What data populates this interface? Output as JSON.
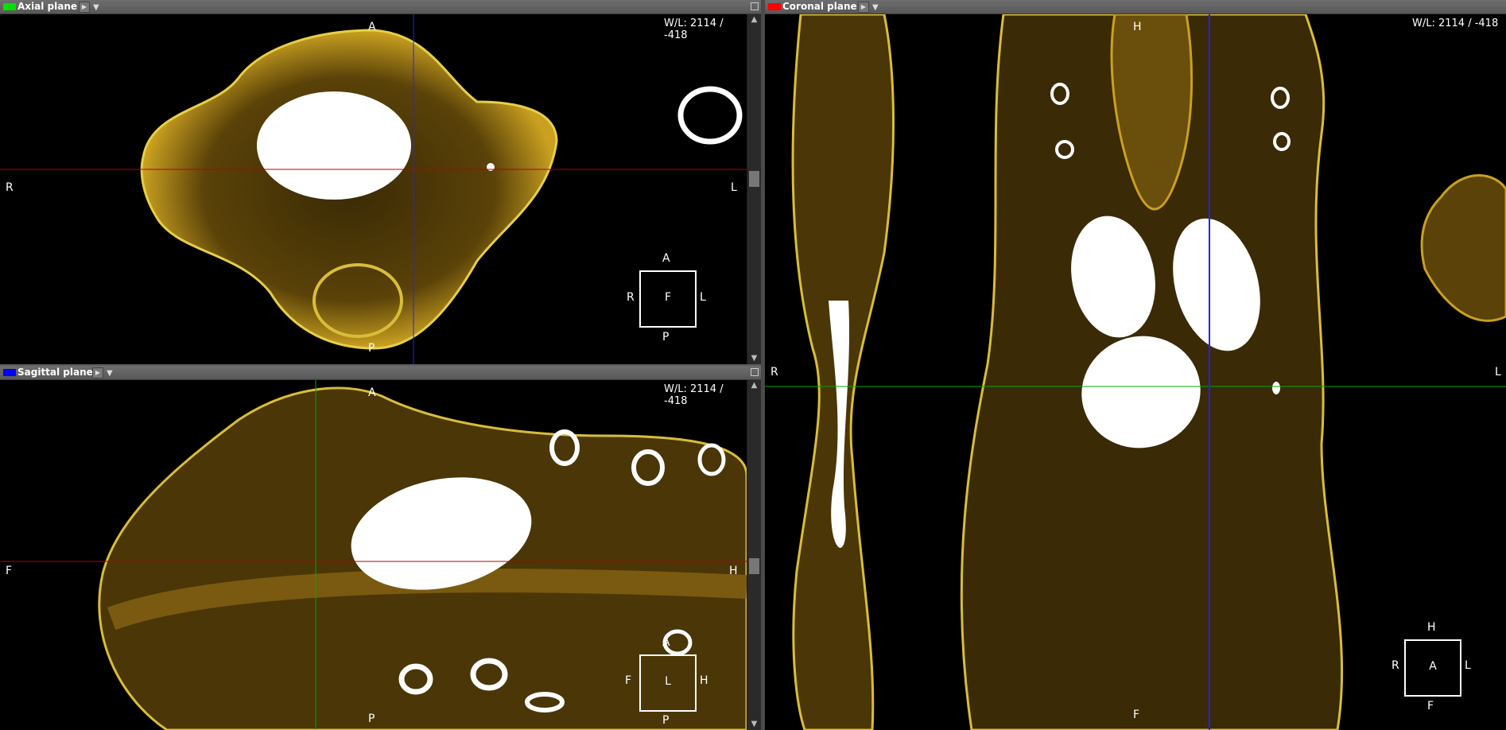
{
  "panes": {
    "axial": {
      "title": "Axial plane",
      "color": "#00e000",
      "wl": "W/L: 2114 / -418",
      "top": "A",
      "bottom": "P",
      "left": "R",
      "right": "L",
      "box": {
        "top": "A",
        "bottom": "P",
        "left": "R",
        "right": "L",
        "center": "F"
      }
    },
    "sagittal": {
      "title": "Sagittal plane",
      "color": "#0000ff",
      "wl": "W/L: 2114 / -418",
      "top": "A",
      "bottom": "P",
      "left": "F",
      "right": "H",
      "box": {
        "top": "A",
        "bottom": "P",
        "left": "F",
        "right": "H",
        "center": "L"
      }
    },
    "coronal": {
      "title": "Coronal plane",
      "color": "#ff0000",
      "wl": "W/L: 2114 / -418",
      "top": "H",
      "bottom": "F",
      "left": "R",
      "right": "L",
      "box": {
        "top": "H",
        "bottom": "F",
        "left": "R",
        "right": "L",
        "center": "A"
      }
    }
  },
  "icons": {
    "play": "play-icon",
    "dropdown": "chevron-down-icon",
    "maximize": "maximize-icon"
  }
}
